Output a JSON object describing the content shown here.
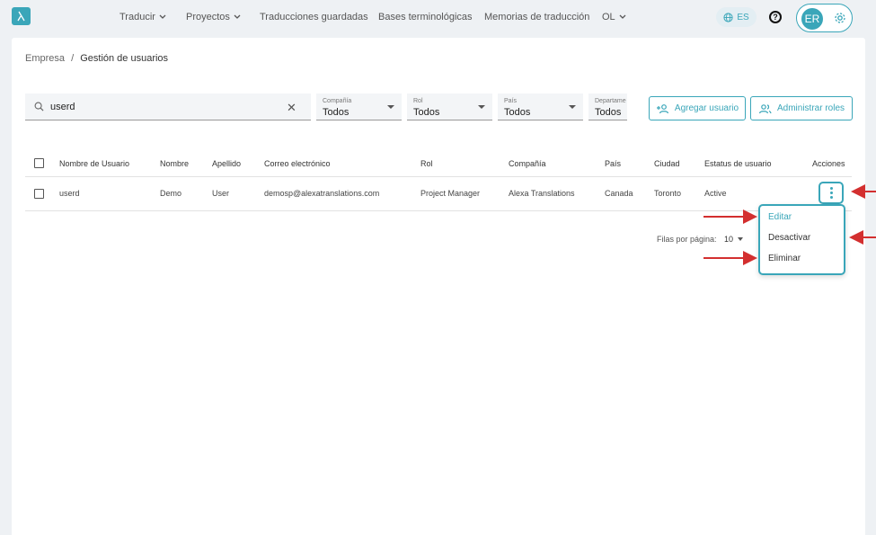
{
  "nav": {
    "items": [
      {
        "label": "Traducir",
        "has_dropdown": true
      },
      {
        "label": "Proyectos",
        "has_dropdown": true
      },
      {
        "label": "Traducciones guardadas",
        "has_dropdown": false
      },
      {
        "label": "Bases terminológicas",
        "has_dropdown": false
      },
      {
        "label": "Memorias de traducción",
        "has_dropdown": false
      },
      {
        "label": "OL",
        "has_dropdown": true
      }
    ],
    "language": "ES",
    "help": "?",
    "avatar_initials": "ER"
  },
  "breadcrumb": {
    "parent": "Empresa",
    "separator": "/",
    "current": "Gestión de usuarios"
  },
  "search": {
    "value": "userd"
  },
  "filters": [
    {
      "label": "Compañía",
      "value": "Todos"
    },
    {
      "label": "Rol",
      "value": "Todos"
    },
    {
      "label": "País",
      "value": "Todos"
    },
    {
      "label": "Departame",
      "value": "Todos"
    }
  ],
  "buttons": {
    "add_user": "Agregar usuario",
    "manage_roles": "Administrar roles"
  },
  "table": {
    "headers": [
      "Nombre de Usuario",
      "Nombre",
      "Apellido",
      "Correo electrónico",
      "Rol",
      "Compañía",
      "País",
      "Ciudad",
      "Estatus de usuario",
      "Acciones"
    ],
    "rows": [
      [
        "userd",
        "Demo",
        "User",
        "demosp@alexatranslations.com",
        "Project Manager",
        "Alexa Translations",
        "Canada",
        "Toronto",
        "Active"
      ]
    ]
  },
  "pagination": {
    "label": "Filas por página:",
    "value": "10"
  },
  "actions_menu": {
    "items": [
      "Editar",
      "Desactivar",
      "Eliminar"
    ]
  },
  "colors": {
    "accent": "#3aa6b9",
    "arrow": "#d32f2f"
  }
}
